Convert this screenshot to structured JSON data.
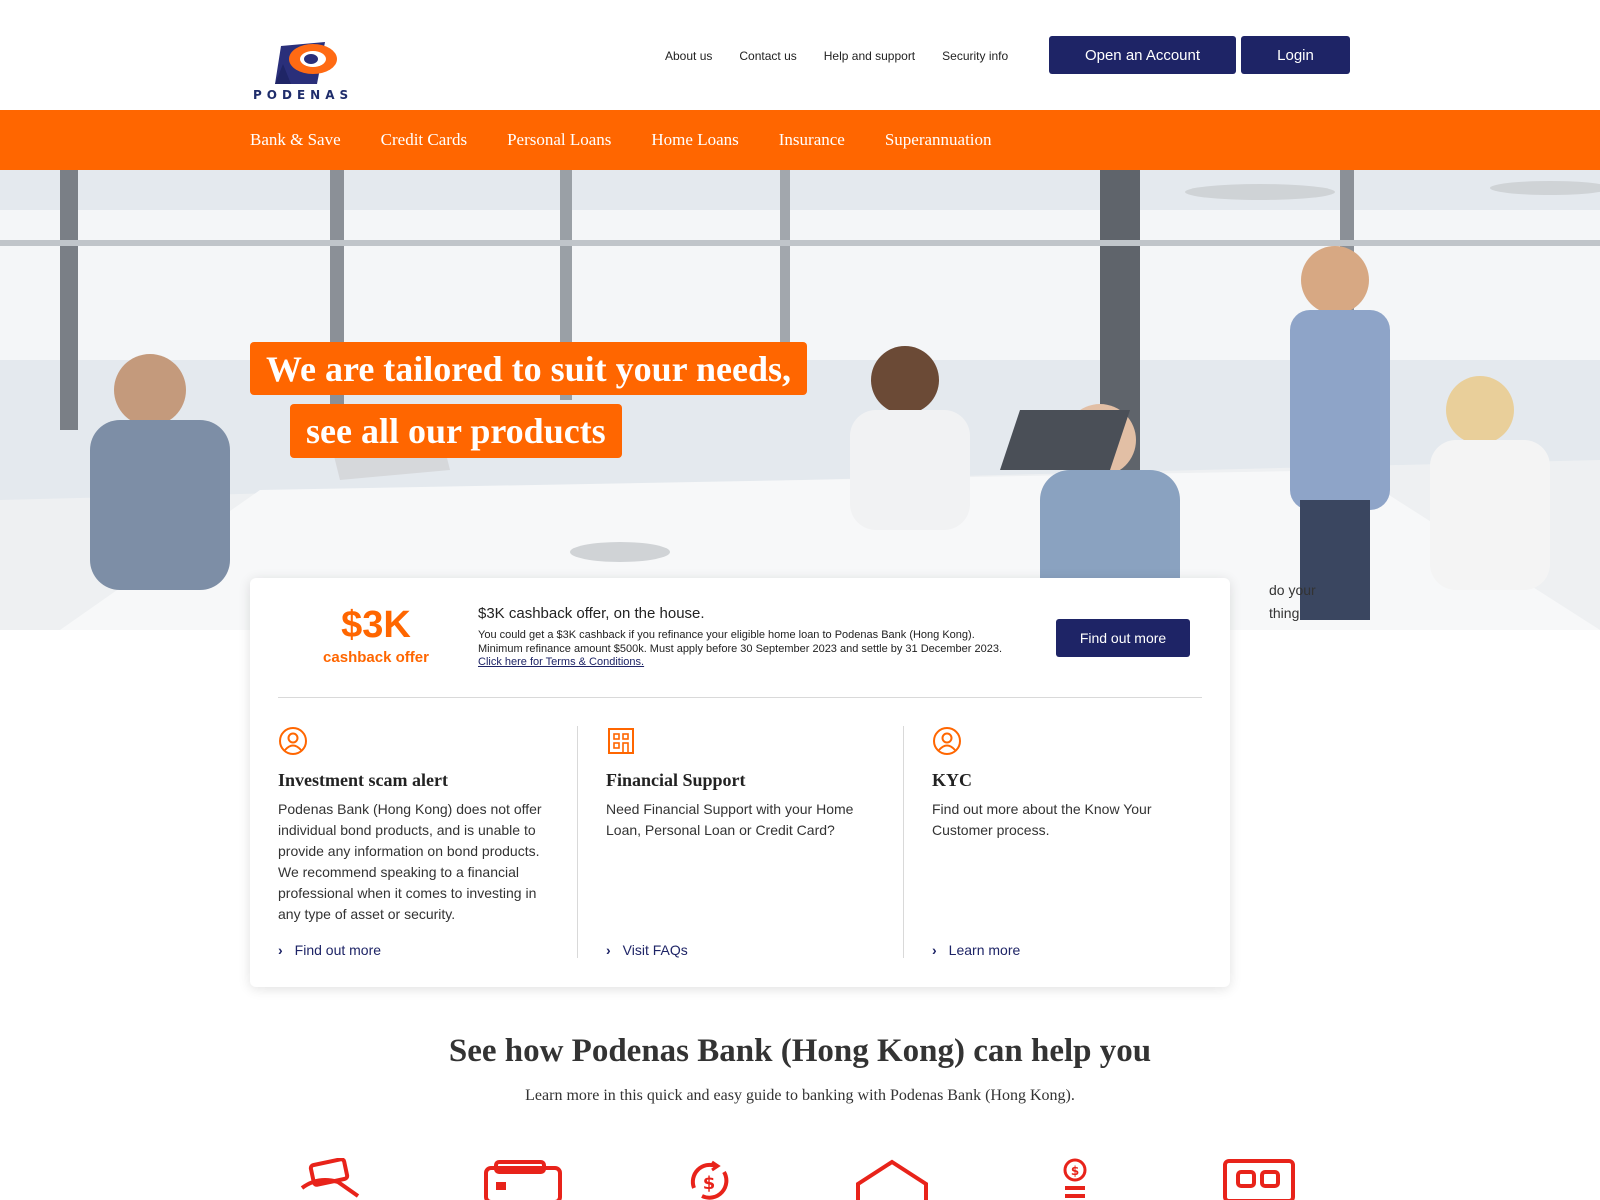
{
  "header": {
    "logo_text": "PODENAS",
    "utility_links": [
      "About us",
      "Contact us",
      "Help and support",
      "Security info"
    ],
    "open_account_label": "Open an Account",
    "login_label": "Login"
  },
  "nav": {
    "items": [
      "Bank & Save",
      "Credit Cards",
      "Personal Loans",
      "Home Loans",
      "Insurance",
      "Superannuation"
    ]
  },
  "hero": {
    "line1": "We are tailored to suit your needs,",
    "line2": "see all our products",
    "broken_image_alt": "do your thing"
  },
  "offer": {
    "amount": "$3K",
    "amount_caption": "cashback offer",
    "title": "$3K cashback offer, on the house.",
    "body": "You could get a $3K cashback if you refinance your eligible home loan to Podenas Bank (Hong Kong). Minimum refinance amount $500k. Must apply before 30 September 2023 and settle by 31 December 2023.",
    "terms_link": "Click here for Terms & Conditions.",
    "button_label": "Find out more"
  },
  "columns": [
    {
      "icon": "user-circle-icon",
      "title": "Investment scam alert",
      "text": "Podenas Bank (Hong Kong) does not offer individual bond products, and is unable to provide any information on bond products. We recommend speaking to a financial professional when it comes to investing in any type of asset or security.",
      "link": "Find out more"
    },
    {
      "icon": "building-icon",
      "title": "Financial Support",
      "text": "Need Financial Support with your Home Loan, Personal Loan or Credit Card?",
      "link": "Visit FAQs"
    },
    {
      "icon": "user-circle-icon",
      "title": "KYC",
      "text": "Find out more about the Know Your Customer process.",
      "link": "Learn more"
    }
  ],
  "help": {
    "title": "See how Podenas Bank (Hong Kong) can help you",
    "subtitle": "Learn more in this quick and easy guide to banking with Podenas Bank (Hong Kong).",
    "icons": [
      "hand-card-icon",
      "wallet-icon",
      "money-cycle-icon",
      "home-icon",
      "coin-stack-icon",
      "atm-icon"
    ]
  },
  "colors": {
    "brand_orange": "#ff6600",
    "brand_navy": "#1e2466",
    "help_icon_red": "#e8231a"
  }
}
